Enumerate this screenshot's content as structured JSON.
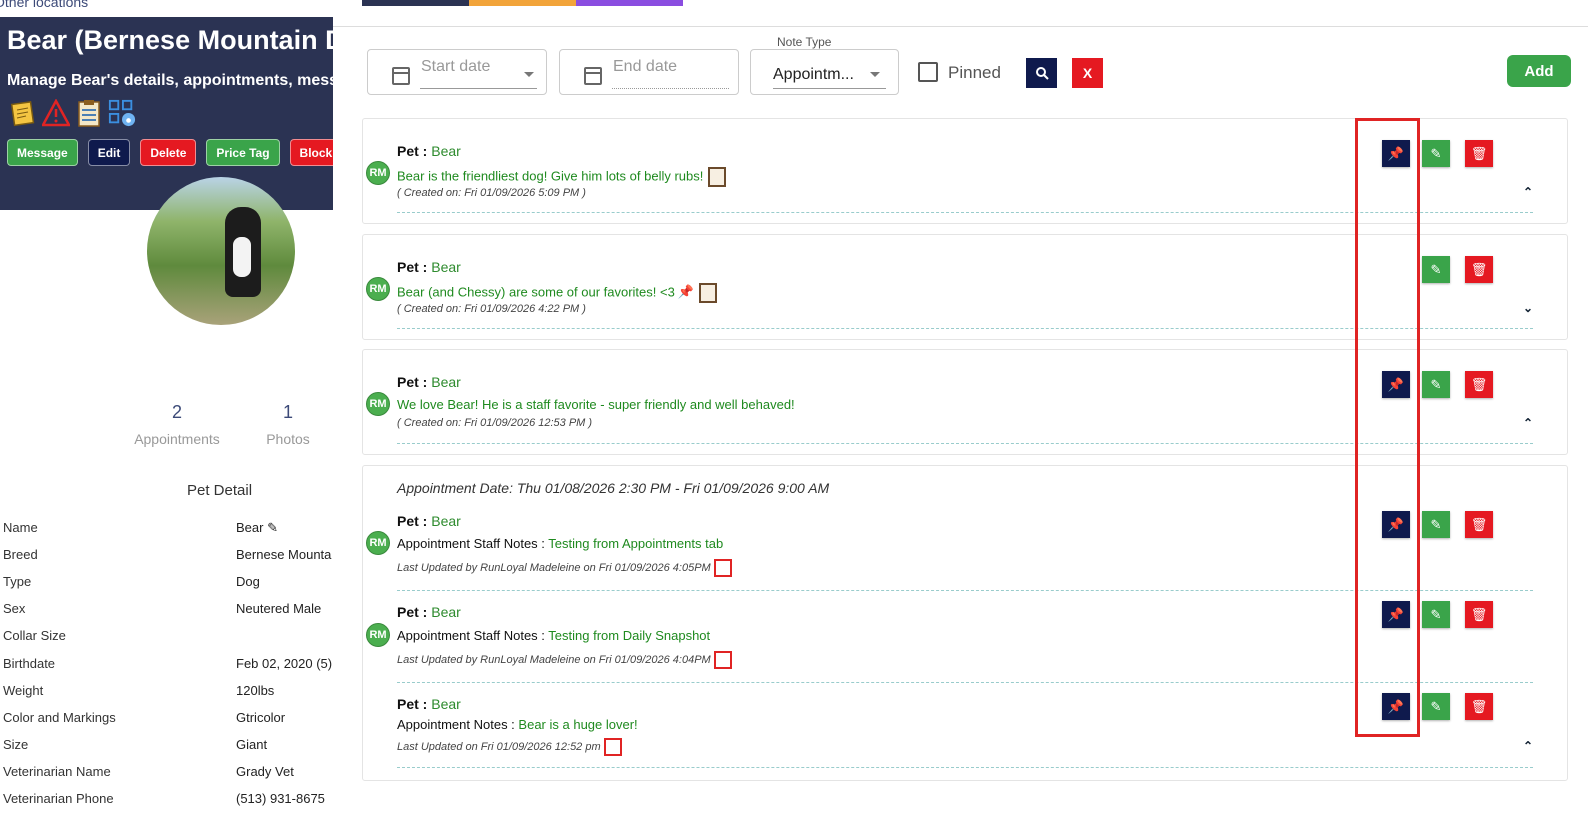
{
  "left": {
    "other_locations": "Other locations",
    "title": "Bear (Bernese Mountain Do",
    "subtitle": "Manage Bear's details, appointments, messa",
    "icons": [
      "note-icon",
      "warning-icon",
      "clipboard-icon",
      "qr-icon"
    ],
    "buttons": [
      {
        "label": "Message",
        "color": "#3aa44a"
      },
      {
        "label": "Edit",
        "color": "#0f1a4d"
      },
      {
        "label": "Delete",
        "color": "#e51921"
      },
      {
        "label": "Price Tag",
        "color": "#3aa44a"
      },
      {
        "label": "Block",
        "color": "#e51921"
      }
    ],
    "stats": [
      {
        "value": "2",
        "label": "Appointments"
      },
      {
        "value": "1",
        "label": "Photos"
      }
    ],
    "pet_detail_title": "Pet Detail",
    "details": [
      {
        "label": "Name",
        "value": "Bear"
      },
      {
        "label": "Breed",
        "value": "Bernese Mounta"
      },
      {
        "label": "Type",
        "value": "Dog"
      },
      {
        "label": "Sex",
        "value": "Neutered Male"
      },
      {
        "label": "Collar Size",
        "value": ""
      },
      {
        "label": "Birthdate",
        "value": "Feb 02, 2020  (5)"
      },
      {
        "label": "Weight",
        "value": "120lbs"
      },
      {
        "label": "Color and Markings",
        "value": "Gtricolor"
      },
      {
        "label": "Size",
        "value": "Giant"
      },
      {
        "label": "Veterinarian Name",
        "value": "Grady Vet"
      },
      {
        "label": "Veterinarian Phone",
        "value": "(513) 931-8675"
      }
    ]
  },
  "filters": {
    "start_date_placeholder": "Start date",
    "end_date_placeholder": "End date",
    "note_type_label": "Note Type",
    "note_type_value": "Appointm...",
    "pinned_label": "Pinned",
    "search_icon": "search-icon",
    "clear_label": "X",
    "add_label": "Add"
  },
  "tab_colors": [
    "#2b3353",
    "#f2a43a",
    "#8a4de0"
  ],
  "notes": [
    {
      "pet_label": "Pet :",
      "pet_name": "Bear",
      "initials": "RM",
      "text": "Bear is the friendliest dog! Give him lots of belly rubs!",
      "meta": "( Created on: Fri 01/09/2026 5:09 PM )",
      "pinned_btn": true,
      "chevron": "up"
    },
    {
      "pet_label": "Pet :",
      "pet_name": "Bear",
      "initials": "RM",
      "text": "Bear (and Chessy) are some of our favorites! <3",
      "meta": "( Created on: Fri 01/09/2026 4:22 PM )",
      "pinned_btn": false,
      "chevron": "down"
    },
    {
      "pet_label": "Pet :",
      "pet_name": "Bear",
      "initials": "RM",
      "text": "We love Bear! He is a staff favorite - super friendly and well behaved!",
      "meta": "( Created on: Fri 01/09/2026 12:53 PM )",
      "pinned_btn": true,
      "chevron": "up"
    }
  ],
  "appointment_group": {
    "date_text": "Appointment Date: Thu 01/08/2026 2:30 PM - Fri 01/09/2026 9:00 AM",
    "items": [
      {
        "pet_label": "Pet :",
        "pet_name": "Bear",
        "initials": "RM",
        "label": "Appointment Staff Notes :",
        "text": "Testing from Appointments tab",
        "meta": "Last Updated by RunLoyal Madeleine on Fri 01/09/2026 4:05PM"
      },
      {
        "pet_label": "Pet :",
        "pet_name": "Bear",
        "initials": "RM",
        "label": "Appointment Staff Notes :",
        "text": "Testing from Daily Snapshot",
        "meta": "Last Updated by RunLoyal Madeleine on Fri 01/09/2026 4:04PM"
      },
      {
        "pet_label": "Pet :",
        "pet_name": "Bear",
        "initials": "",
        "label": "Appointment Notes :",
        "text": "Bear is a huge lover!",
        "meta": "Last Updated on Fri 01/09/2026 12:52 pm"
      }
    ]
  }
}
